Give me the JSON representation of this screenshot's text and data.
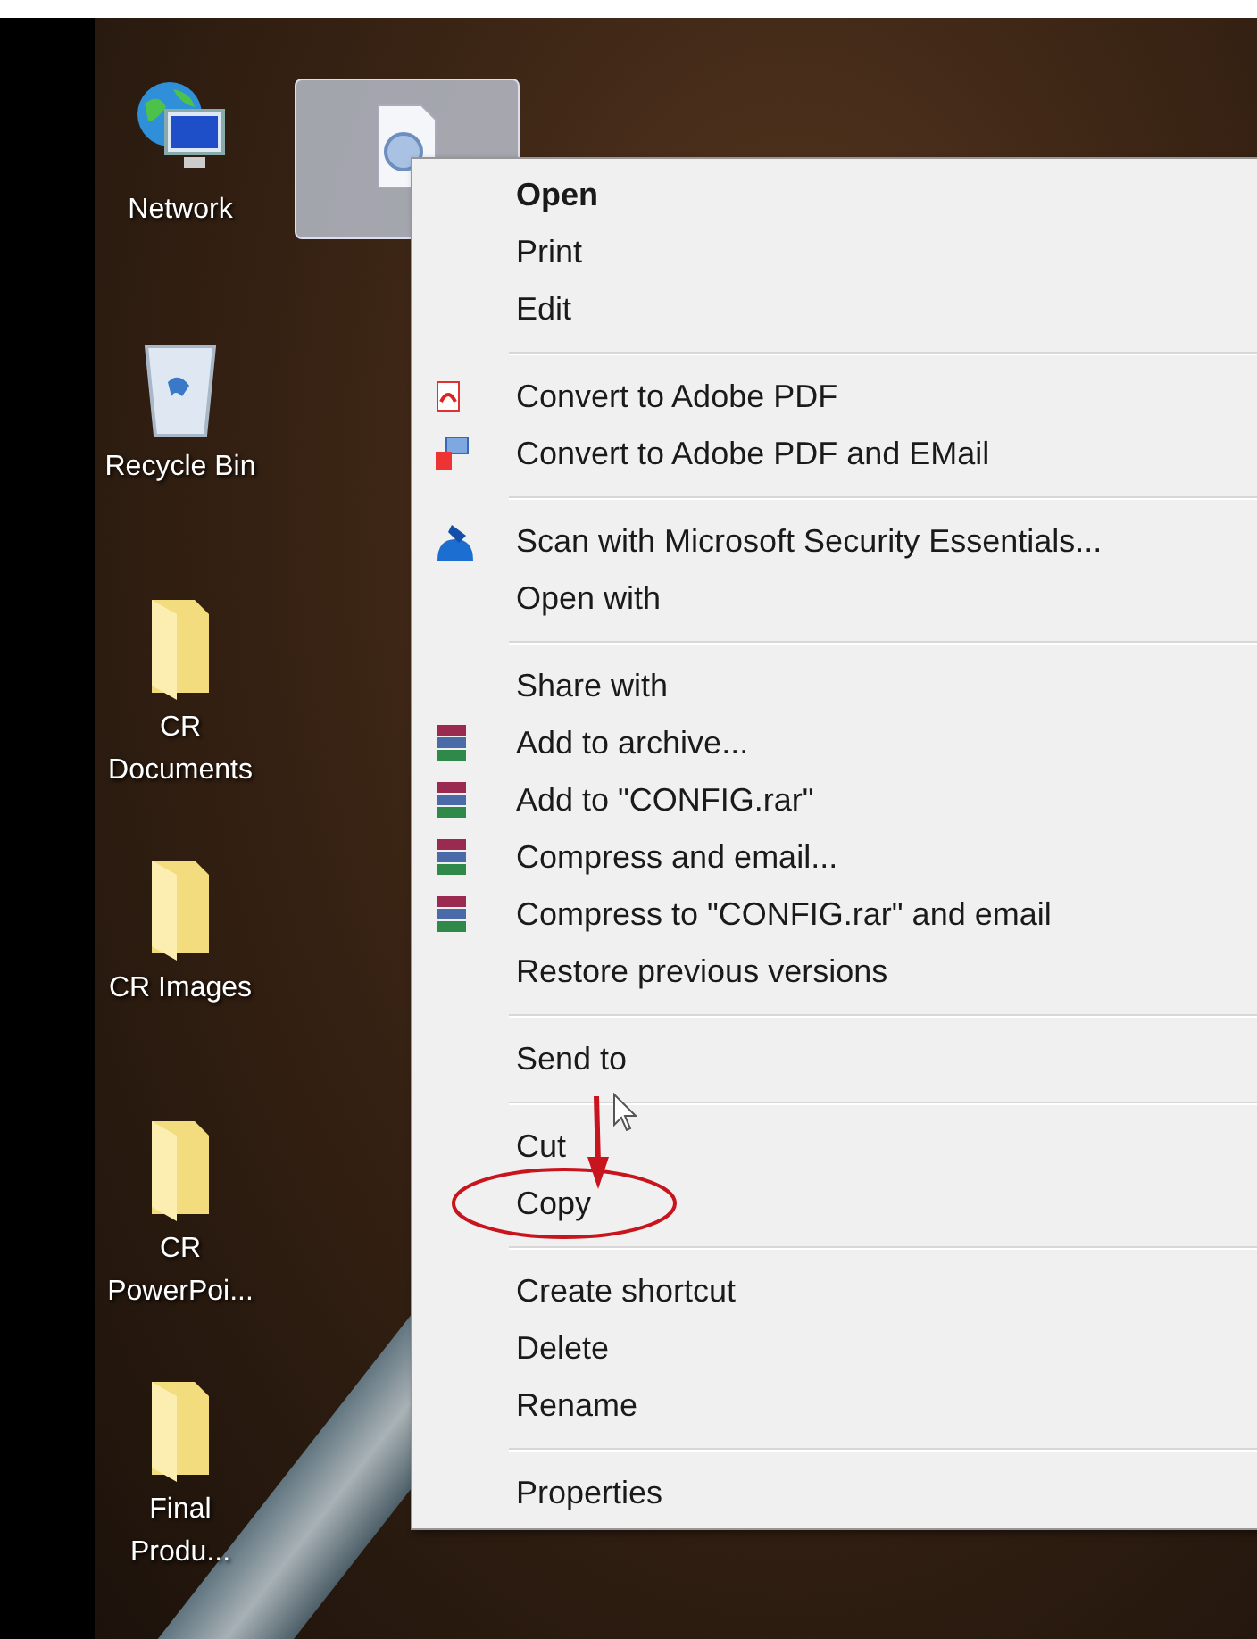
{
  "desktop": {
    "icons": [
      {
        "label": "Network",
        "kind": "network"
      },
      {
        "label": "Recycle Bin",
        "kind": "recycle"
      },
      {
        "label": "CR Documents",
        "kind": "folder"
      },
      {
        "label": "CR Images",
        "kind": "folder"
      },
      {
        "label": "CR PowerPoi...",
        "kind": "folder"
      },
      {
        "label": "Final Produ...",
        "kind": "folder"
      }
    ],
    "selected_file": {
      "kind": "file",
      "selected": true
    }
  },
  "context_menu": {
    "groups": [
      {
        "items": [
          {
            "label": "Open",
            "kind": "plain",
            "default": true,
            "circled": false
          },
          {
            "label": "Print",
            "kind": "plain",
            "default": false,
            "circled": false
          },
          {
            "label": "Edit",
            "kind": "plain",
            "default": false,
            "circled": false
          }
        ]
      },
      {
        "items": [
          {
            "label": "Convert to Adobe PDF",
            "kind": "pdf",
            "default": false,
            "circled": false
          },
          {
            "label": "Convert to Adobe PDF and EMail",
            "kind": "pdfmail",
            "default": false,
            "circled": false
          }
        ]
      },
      {
        "items": [
          {
            "label": "Scan with Microsoft Security Essentials...",
            "kind": "scan",
            "default": false,
            "circled": false
          },
          {
            "label": "Open with",
            "kind": "plain",
            "default": false,
            "circled": false
          }
        ]
      },
      {
        "items": [
          {
            "label": "Share with",
            "kind": "plain",
            "default": false,
            "circled": false
          },
          {
            "label": "Add to archive...",
            "kind": "archive",
            "default": false,
            "circled": false
          },
          {
            "label": "Add to \"CONFIG.rar\"",
            "kind": "archive",
            "default": false,
            "circled": false
          },
          {
            "label": "Compress and email...",
            "kind": "archive",
            "default": false,
            "circled": false
          },
          {
            "label": "Compress to \"CONFIG.rar\" and email",
            "kind": "archive",
            "default": false,
            "circled": false
          },
          {
            "label": "Restore previous versions",
            "kind": "plain",
            "default": false,
            "circled": false
          }
        ]
      },
      {
        "items": [
          {
            "label": "Send to",
            "kind": "plain",
            "default": false,
            "circled": false
          }
        ]
      },
      {
        "items": [
          {
            "label": "Cut",
            "kind": "plain",
            "default": false,
            "circled": false
          },
          {
            "label": "Copy",
            "kind": "plain",
            "default": false,
            "circled": true
          }
        ]
      },
      {
        "items": [
          {
            "label": "Create shortcut",
            "kind": "plain",
            "default": false,
            "circled": false
          },
          {
            "label": "Delete",
            "kind": "plain",
            "default": false,
            "circled": false
          },
          {
            "label": "Rename",
            "kind": "plain",
            "default": false,
            "circled": false
          }
        ]
      },
      {
        "items": [
          {
            "label": "Properties",
            "kind": "plain",
            "default": false,
            "circled": false
          }
        ]
      }
    ]
  }
}
